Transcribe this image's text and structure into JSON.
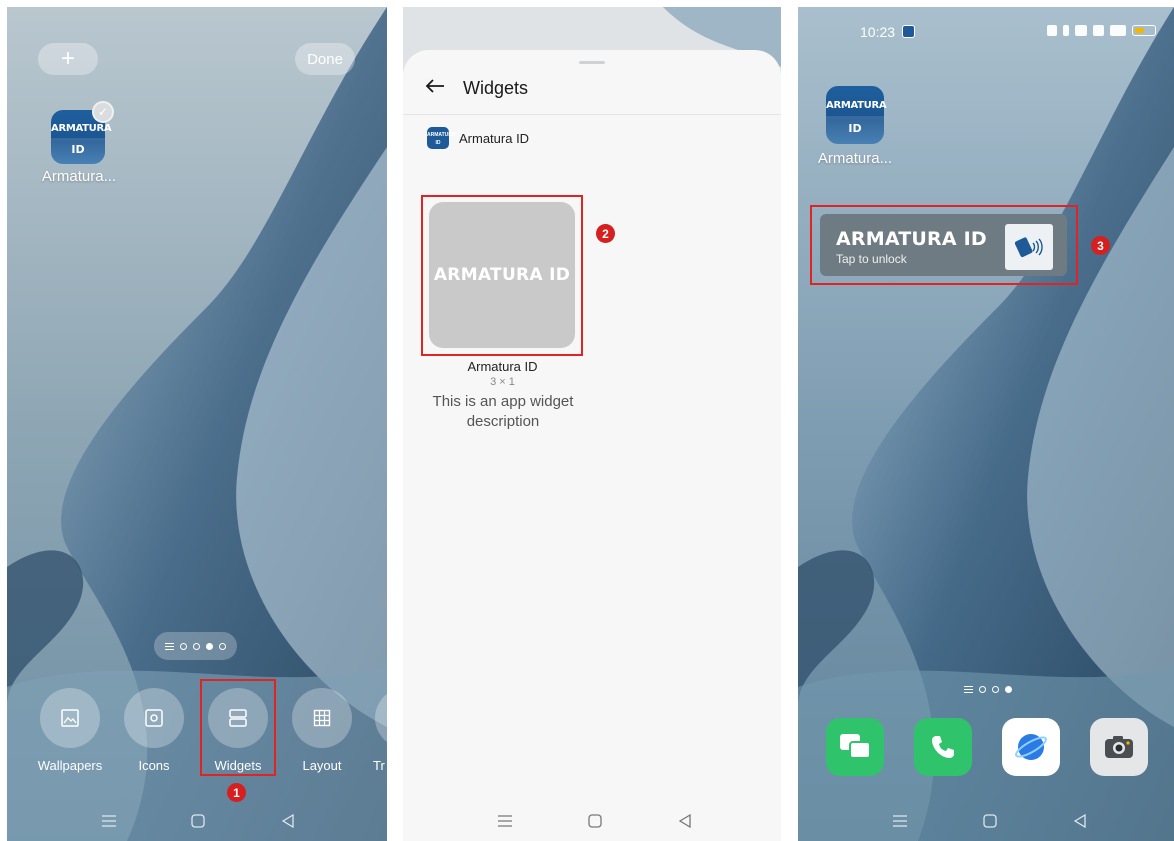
{
  "screen1": {
    "add_button": "+",
    "done_button": "Done",
    "app_icon": {
      "line1": "ARMATURA",
      "line2": "ID",
      "label": "Armatura..."
    },
    "page_indicator": {
      "pages": 4,
      "current": 3
    },
    "edit_options": [
      {
        "label": "Wallpapers",
        "icon": "image-icon"
      },
      {
        "label": "Icons",
        "icon": "icon-style-icon"
      },
      {
        "label": "Widgets",
        "icon": "widgets-icon"
      },
      {
        "label": "Layout",
        "icon": "grid-icon"
      },
      {
        "label": "Tr",
        "icon": "transition-icon"
      }
    ],
    "step_number": "1"
  },
  "screen2": {
    "title": "Widgets",
    "provider": {
      "name": "Armatura ID",
      "icon_line1": "ARMATURA",
      "icon_line2": "ID"
    },
    "widget": {
      "preview_text": "ARMATURA ID",
      "name": "Armatura ID",
      "size": "3 × 1",
      "description": "This is an app widget description"
    },
    "step_number": "2"
  },
  "screen3": {
    "status_bar": {
      "time": "10:23"
    },
    "app_icon": {
      "line1": "ARMATURA",
      "line2": "ID",
      "label": "Armatura..."
    },
    "widget": {
      "title": "ARMATURA ID",
      "subtitle": "Tap to unlock"
    },
    "page_indicator": {
      "pages": 3,
      "current": 3
    },
    "dock": [
      "messages-icon",
      "phone-icon",
      "browser-icon",
      "camera-icon"
    ],
    "step_number": "3"
  },
  "colors": {
    "annotation_red": "#e02424",
    "app_blue": "#1d5a97",
    "widget_grey": "#c9c9c9",
    "widget_bar": "#6f7b82"
  }
}
